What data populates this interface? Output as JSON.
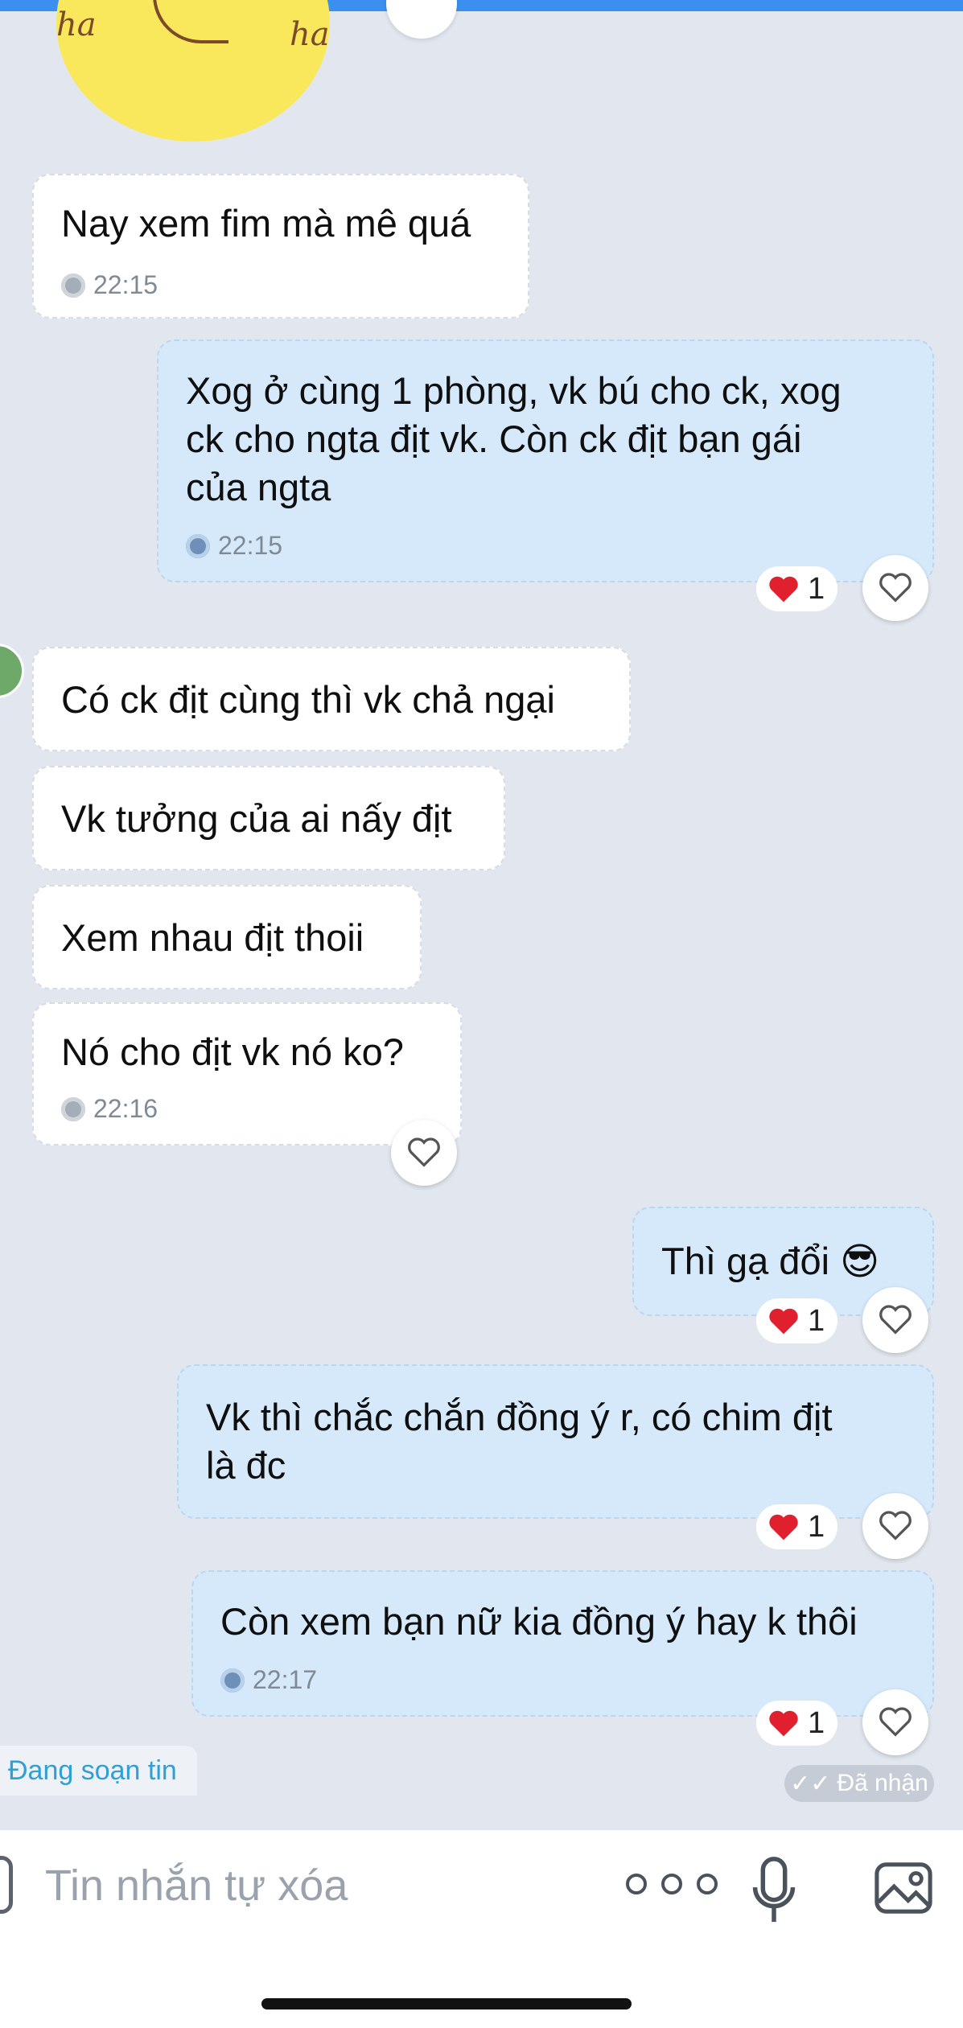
{
  "messages": [
    {
      "text_lines": [
        "Nay xem fim mà mê quá"
      ],
      "time": "22:15"
    },
    {
      "text_lines": [
        "Xog ở cùng 1 phòng, vk bú cho ck, xog",
        "ck cho ngta địt vk. Còn ck địt bạn gái",
        "của ngta"
      ],
      "time": "22:15",
      "reaction_count": "1"
    },
    {
      "text_lines": [
        "Có ck địt cùng thì vk chả ngại"
      ]
    },
    {
      "text_lines": [
        "Vk tưởng của ai nấy địt"
      ]
    },
    {
      "text_lines": [
        "Xem nhau địt thoii"
      ]
    },
    {
      "text_lines": [
        "Nó cho địt vk nó ko?"
      ],
      "time": "22:16"
    },
    {
      "text_lines": [
        "Thì gạ đổi 😎"
      ],
      "reaction_count": "1"
    },
    {
      "text_lines": [
        "Vk thì chắc chắn đồng ý r, có chim địt",
        "là đc"
      ],
      "reaction_count": "1"
    },
    {
      "text_lines": [
        "Còn xem bạn nữ kia đồng ý hay k thôi"
      ],
      "time": "22:17",
      "reaction_count": "1"
    }
  ],
  "status": {
    "typing": "Đang soạn tin",
    "delivered": "Đã nhận"
  },
  "composer": {
    "placeholder": "Tin nhắn tự xóa"
  },
  "icons": [
    "heart-icon",
    "clock-icon",
    "more-icon",
    "microphone-icon",
    "image-icon"
  ],
  "colors": {
    "incoming_bubble": "#ffffff",
    "outgoing_bubble": "#d5e9fb",
    "background": "#e2e7ef",
    "reaction_heart": "#e0202e",
    "typing_text": "#2f9fd6"
  }
}
